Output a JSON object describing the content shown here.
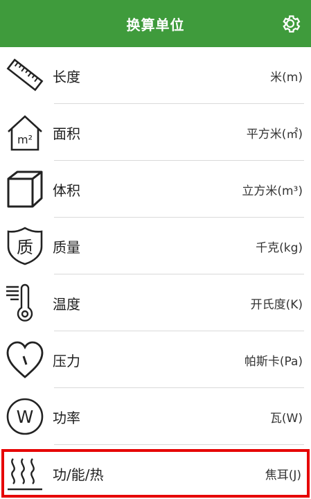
{
  "header": {
    "title": "换算单位"
  },
  "items": [
    {
      "label": "长度",
      "unit": "米(m)",
      "icon": "ruler-icon"
    },
    {
      "label": "面积",
      "unit": "平方米(㎡)",
      "icon": "area-house-icon",
      "icon_text": "m²"
    },
    {
      "label": "体积",
      "unit": "立方米(m³)",
      "icon": "cube-icon"
    },
    {
      "label": "质量",
      "unit": "千克(kg)",
      "icon": "mass-shield-icon",
      "icon_text": "质"
    },
    {
      "label": "温度",
      "unit": "开氏度(K)",
      "icon": "thermometer-icon"
    },
    {
      "label": "压力",
      "unit": "帕斯卡(Pa)",
      "icon": "pressure-heart-icon"
    },
    {
      "label": "功率",
      "unit": "瓦(W)",
      "icon": "power-w-icon",
      "icon_text": "W"
    },
    {
      "label": "功/能/热",
      "unit": "焦耳(J)",
      "icon": "heat-waves-icon"
    }
  ],
  "colors": {
    "header": "#3f9b3c",
    "highlight": "#e60000"
  }
}
